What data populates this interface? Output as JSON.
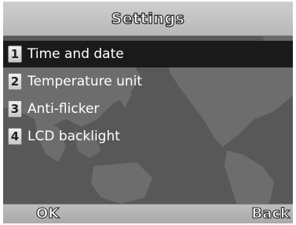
{
  "header": {
    "title": "Settings"
  },
  "menu": {
    "selected_index": 0,
    "items": [
      {
        "number": "1",
        "label": "Time and date"
      },
      {
        "number": "2",
        "label": "Temperature unit"
      },
      {
        "number": "3",
        "label": "Anti-flicker"
      },
      {
        "number": "4",
        "label": "LCD backlight"
      }
    ]
  },
  "softkeys": {
    "left": "OK",
    "right": "Back"
  },
  "colors": {
    "selected_row": "#1a1a1a",
    "map_ocean": "#5a5a5a",
    "map_land": "#6e6e6e",
    "bars": "#bdbdbd"
  }
}
